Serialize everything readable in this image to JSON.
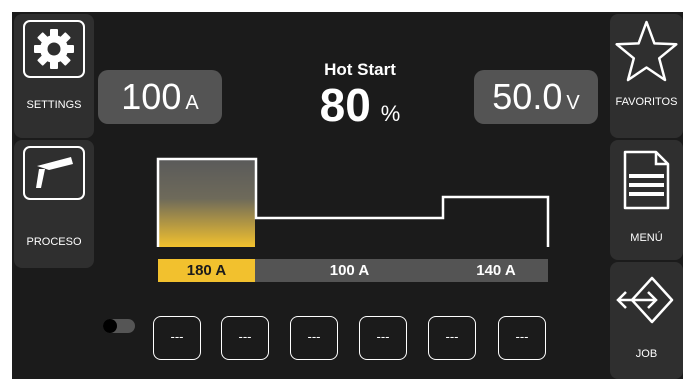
{
  "left_menu": {
    "settings_label": "SETTINGS",
    "process_label": "PROCESO"
  },
  "right_menu": {
    "favorites_label": "FAVORITOS",
    "menu_label": "MENÚ",
    "job_label": "JOB"
  },
  "readouts": {
    "current_value": "100",
    "current_unit": "A",
    "voltage_value": "50.0",
    "voltage_unit": "V"
  },
  "parameter": {
    "title": "Hot Start",
    "value": "80",
    "unit": "%"
  },
  "profile": {
    "segments": [
      {
        "label": "180 A",
        "active": true
      },
      {
        "label": "100 A",
        "active": false
      },
      {
        "label": "140 A",
        "active": false
      }
    ]
  },
  "memory_slots": [
    "---",
    "---",
    "---",
    "---",
    "---",
    "---"
  ],
  "colors": {
    "accent": "#f2c12e",
    "panel": "#1b1b1b",
    "button": "#2f2f2f",
    "readout_bg": "#545454"
  },
  "icons": [
    "gear-icon",
    "welding-torch-icon",
    "star-icon",
    "document-menu-icon",
    "job-arrows-icon"
  ]
}
